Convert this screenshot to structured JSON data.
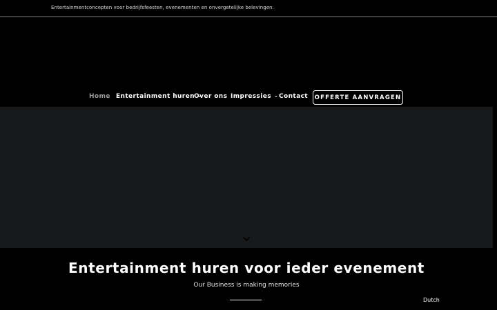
{
  "topbar": {
    "tagline": "Entertainmentconcepten voor bedrijfsfeesten, evenementen en onvergetelijke belevingen."
  },
  "nav": {
    "items": [
      {
        "label": "Home",
        "active": true,
        "has_dropdown": false
      },
      {
        "label": "Entertainment huren",
        "active": false,
        "has_dropdown": true
      },
      {
        "label": "Over ons",
        "active": false,
        "has_dropdown": false
      },
      {
        "label": "Impressies",
        "active": false,
        "has_dropdown": true
      },
      {
        "label": "Contact",
        "active": false,
        "has_dropdown": false
      }
    ],
    "caret_glyph": "⌄",
    "cta_label": "OFFERTE AANVRAGEN"
  },
  "hero": {
    "scroll_icon": "chevron-down-icon"
  },
  "main": {
    "title": "Entertainment huren voor ieder evenement",
    "subtitle": "Our Business is making memories"
  },
  "language": {
    "label": "Dutch"
  },
  "colors": {
    "background": "#000000",
    "hero": "#18191b",
    "nav_active": "#9a9a9a",
    "text": "#ffffff"
  }
}
